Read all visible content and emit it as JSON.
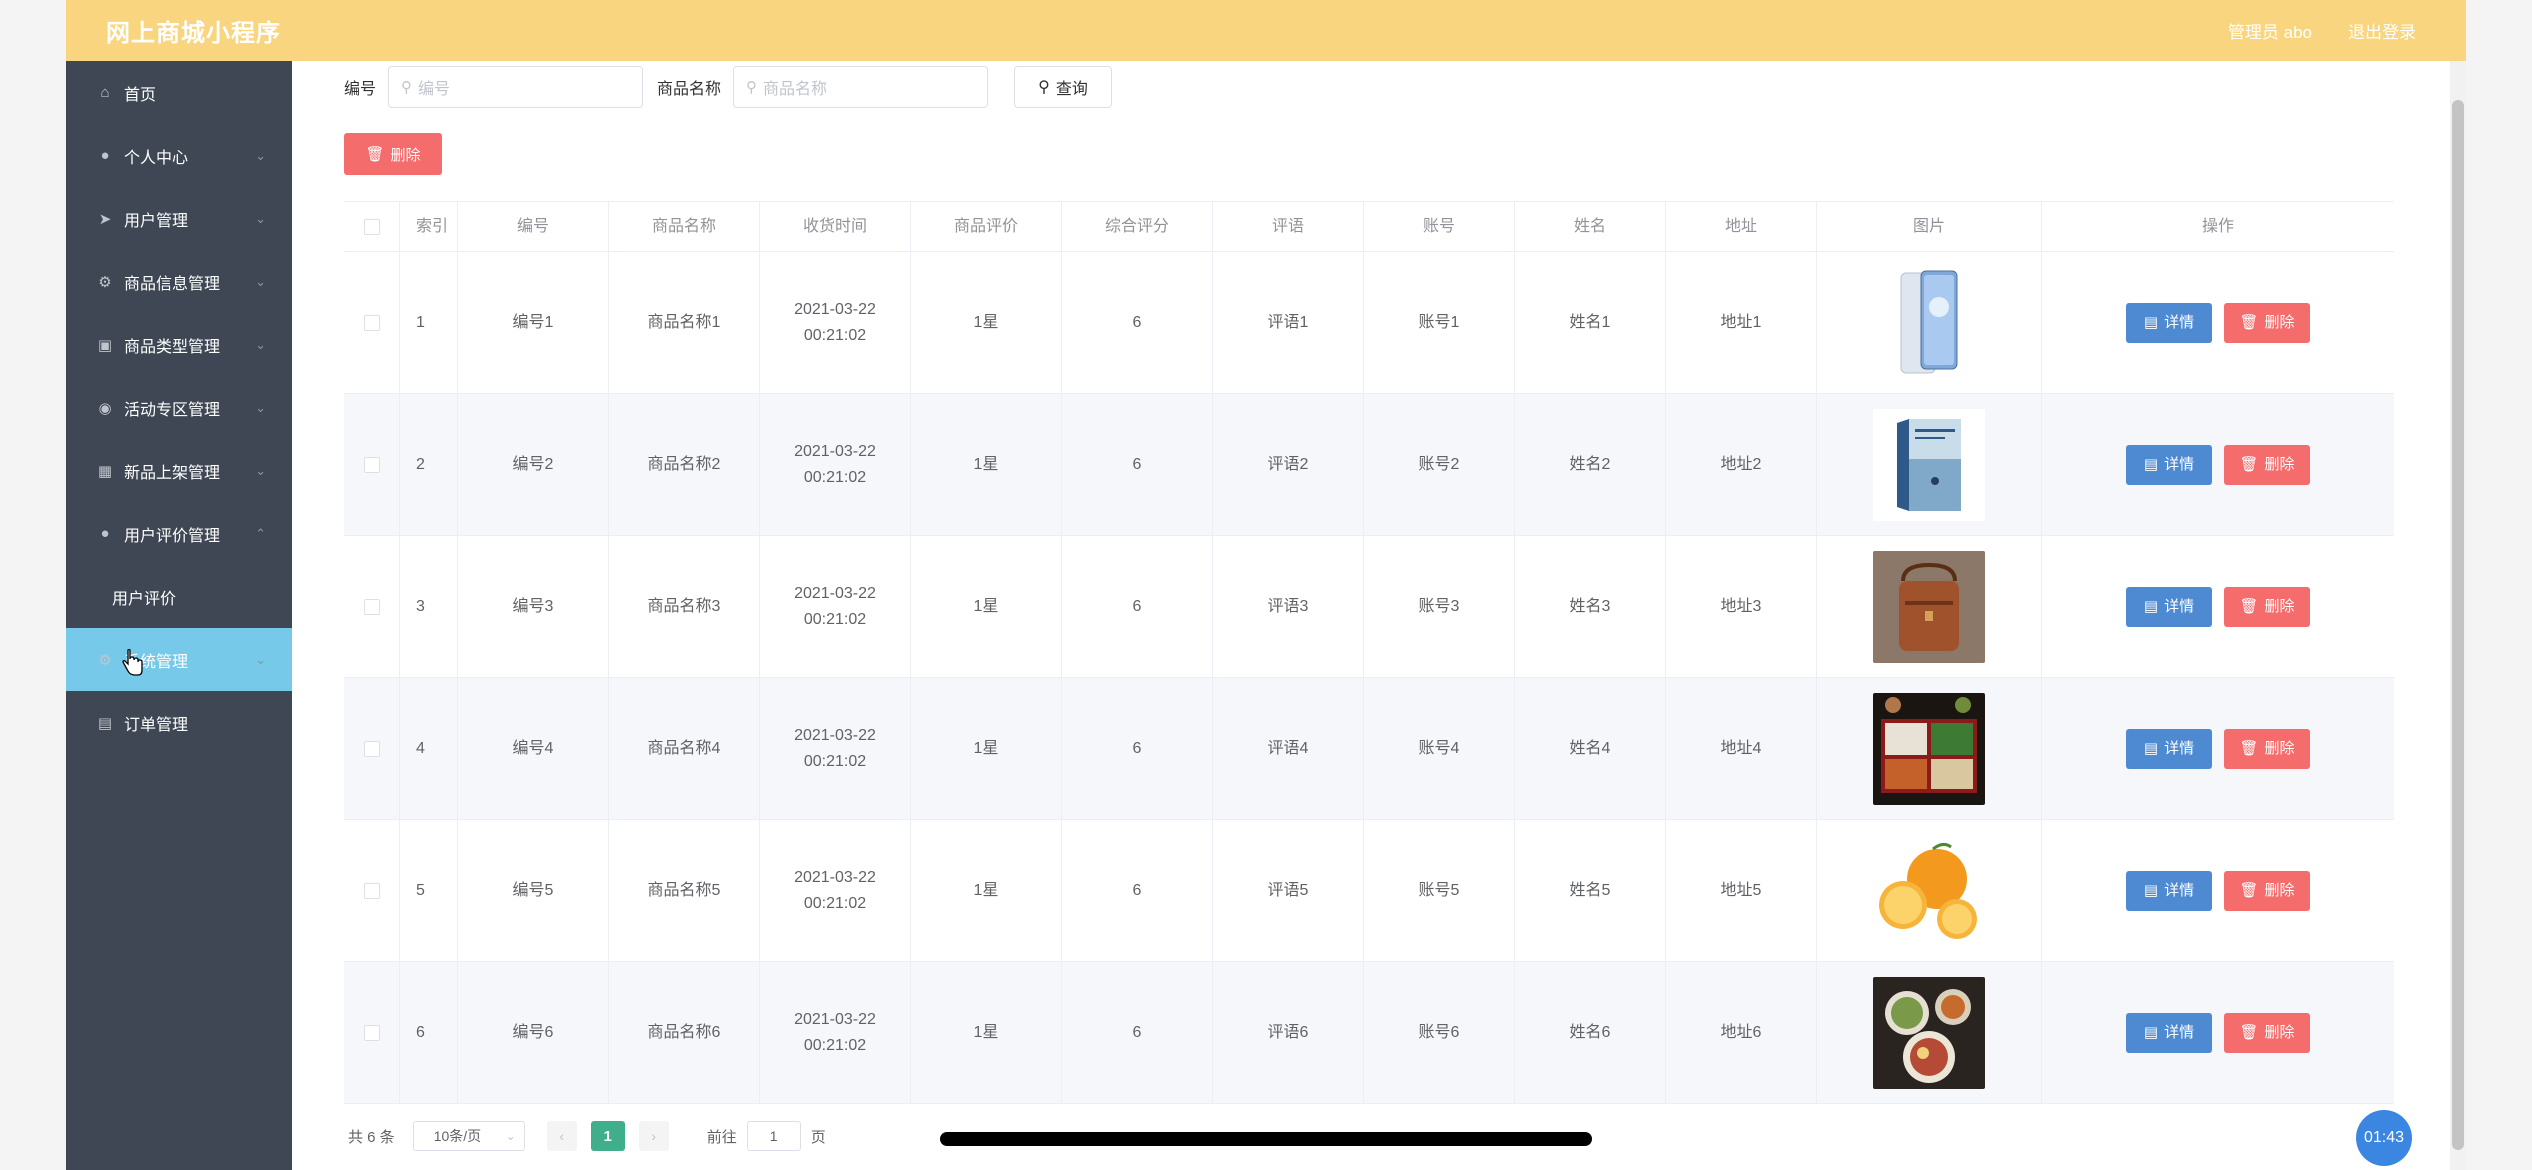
{
  "header": {
    "title": "网上商城小程序",
    "admin": "管理员 abo",
    "logout": "退出登录"
  },
  "sidebar": {
    "items": [
      {
        "label": "首页",
        "icon": "home-icon"
      },
      {
        "label": "个人中心",
        "icon": "user-icon"
      },
      {
        "label": "用户管理",
        "icon": "send-icon"
      },
      {
        "label": "商品信息管理",
        "icon": "mic-icon"
      },
      {
        "label": "商品类型管理",
        "icon": "bag-icon"
      },
      {
        "label": "活动专区管理",
        "icon": "location-icon"
      },
      {
        "label": "新品上架管理",
        "icon": "grid-icon"
      },
      {
        "label": "用户评价管理",
        "icon": "user-icon"
      },
      {
        "label": "用户评价",
        "icon": ""
      },
      {
        "label": "系统管理",
        "icon": "gear-icon"
      },
      {
        "label": "订单管理",
        "icon": "tickets-icon"
      }
    ]
  },
  "search": {
    "no_label": "编号",
    "no_placeholder": "编号",
    "name_label": "商品名称",
    "name_placeholder": "商品名称",
    "query_label": "查询"
  },
  "toolbar": {
    "delete_label": "删除"
  },
  "table": {
    "columns": [
      "索引",
      "编号",
      "商品名称",
      "收货时间",
      "商品评价",
      "综合评分",
      "评语",
      "账号",
      "姓名",
      "地址",
      "图片",
      "操作"
    ],
    "detail_label": "详情",
    "delete_label": "删除",
    "rows": [
      {
        "index": "1",
        "no": "编号1",
        "name": "商品名称1",
        "time": "2021-03-22 00:21:02",
        "rating": "1星",
        "score": "6",
        "comment": "评语1",
        "account": "账号1",
        "uname": "姓名1",
        "addr": "地址1"
      },
      {
        "index": "2",
        "no": "编号2",
        "name": "商品名称2",
        "time": "2021-03-22 00:21:02",
        "rating": "1星",
        "score": "6",
        "comment": "评语2",
        "account": "账号2",
        "uname": "姓名2",
        "addr": "地址2"
      },
      {
        "index": "3",
        "no": "编号3",
        "name": "商品名称3",
        "time": "2021-03-22 00:21:02",
        "rating": "1星",
        "score": "6",
        "comment": "评语3",
        "account": "账号3",
        "uname": "姓名3",
        "addr": "地址3"
      },
      {
        "index": "4",
        "no": "编号4",
        "name": "商品名称4",
        "time": "2021-03-22 00:21:02",
        "rating": "1星",
        "score": "6",
        "comment": "评语4",
        "account": "账号4",
        "uname": "姓名4",
        "addr": "地址4"
      },
      {
        "index": "5",
        "no": "编号5",
        "name": "商品名称5",
        "time": "2021-03-22 00:21:02",
        "rating": "1星",
        "score": "6",
        "comment": "评语5",
        "account": "账号5",
        "uname": "姓名5",
        "addr": "地址5"
      },
      {
        "index": "6",
        "no": "编号6",
        "name": "商品名称6",
        "time": "2021-03-22 00:21:02",
        "rating": "1星",
        "score": "6",
        "comment": "评语6",
        "account": "账号6",
        "uname": "姓名6",
        "addr": "地址6"
      }
    ]
  },
  "pager": {
    "total": "共 6 条",
    "page_size": "10条/页",
    "current": "1",
    "goto_prefix": "前往",
    "goto_value": "1",
    "goto_suffix": "页"
  },
  "timer": "01:43",
  "colors": {
    "header": "#f8d57e",
    "sidebar": "#3f4754",
    "active": "#76c9e8",
    "primary": "#4d8ad1",
    "danger": "#f56c6c",
    "page_active": "#3fae8a"
  }
}
